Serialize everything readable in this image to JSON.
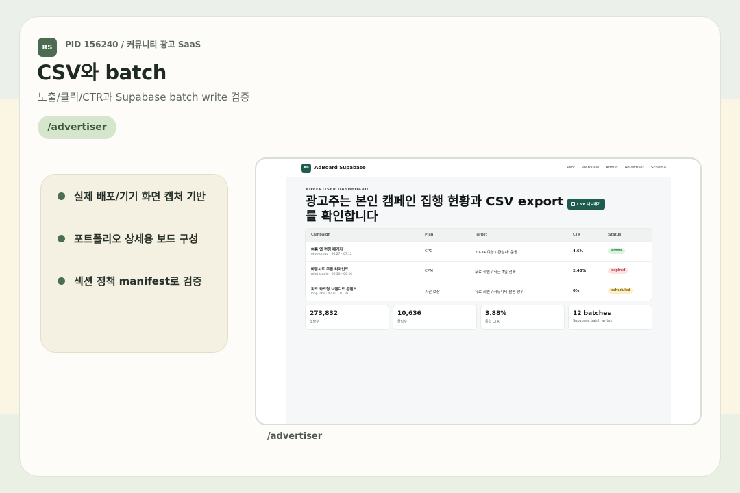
{
  "header": {
    "avatar": "RS",
    "pid": "PID 156240 / 커뮤니티 광고 SaaS",
    "title": "CSV와 batch",
    "subtitle": "노출/클릭/CTR과 Supabase batch write 검증",
    "route": "/advertiser"
  },
  "bullets": [
    "실제 배포/기기 화면 캡처 기반",
    "포트폴리오 상세용 보드 구성",
    "섹션 정책 manifest로 검증"
  ],
  "screenshot_caption": "/advertiser",
  "app": {
    "logo": "AB",
    "brand": "AdBoard Supabase",
    "nav": [
      "Pilot",
      "WebView",
      "Admin",
      "Advertiser",
      "Schema"
    ],
    "eyebrow": "ADVERTISER DASHBOARD",
    "heading": "광고주는 본인 캠페인 집행 현황과 CSV export를 확인합니다",
    "csv_button": "CSV 내보내기",
    "columns": [
      "Campaign",
      "Plan",
      "Target",
      "CTR",
      "Status"
    ],
    "rows": [
      {
        "name": "여름 앱 런칭 패키지",
        "meta": "olive group · 06.27 - 07.12",
        "plan": "CPC",
        "target": "20-34 여성 / 관심사: 운동",
        "ctr": "4.6%",
        "status": "active"
      },
      {
        "name": "바람시트 쿠폰 리마인드",
        "meta": "mint studio · 06.20 - 06.24",
        "plan": "CPM",
        "target": "무료 회원 / 최근 7일 접속",
        "ctr": "2.43%",
        "status": "expired"
      },
      {
        "name": "피드 카드형 브랜디드 콘텐츠",
        "meta": "loop labs · 07.01 - 07.31",
        "plan": "기간 보장",
        "target": "유료 회원 / 커뮤니티 활동 상위",
        "ctr": "0%",
        "status": "scheduled"
      }
    ],
    "stats": [
      {
        "value": "273,832",
        "label": "노출수"
      },
      {
        "value": "10,636",
        "label": "클릭수"
      },
      {
        "value": "3.88%",
        "label": "통합 CTR"
      },
      {
        "value": "12 batches",
        "label": "Supabase batch writes"
      }
    ]
  },
  "colors": {
    "accent": "#4d6b50",
    "app_brand": "#1d5c4e",
    "status_active": "#d9f3df",
    "status_expired": "#fde0e0",
    "status_scheduled": "#fbefc8"
  }
}
